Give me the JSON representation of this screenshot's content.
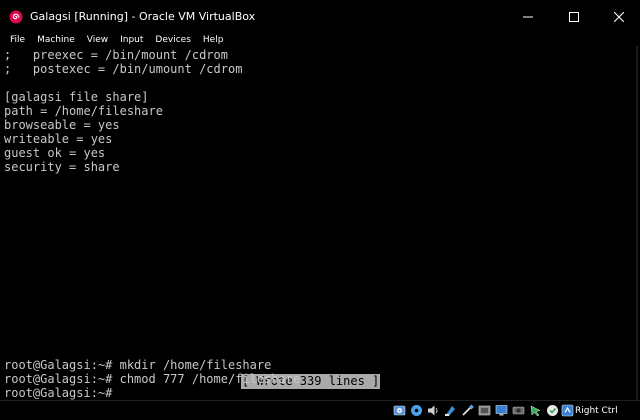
{
  "window": {
    "title": "Galagsi [Running] - Oracle VM VirtualBox"
  },
  "menubar": {
    "items": [
      "File",
      "Machine",
      "View",
      "Input",
      "Devices",
      "Help"
    ]
  },
  "terminal": {
    "lines": [
      ";   preexec = /bin/mount /cdrom",
      ";   postexec = /bin/umount /cdrom",
      "",
      "[galagsi file share]",
      "path = /home/fileshare",
      "browseable = yes",
      "writeable = yes",
      "guest ok = yes",
      "security = share"
    ],
    "status_message": "[ Wrote 339 lines ]",
    "prompt_lines": [
      "root@Galagsi:~# mkdir /home/fileshare",
      "root@Galagsi:~# chmod 777 /home/fileshare",
      "root@Galagsi:~#"
    ]
  },
  "statusbar": {
    "host_key": "Right Ctrl",
    "icons": [
      "hard-disk-icon",
      "optical-drive-icon",
      "audio-icon",
      "network-icon",
      "usb-icon",
      "shared-folders-icon",
      "display-icon",
      "video-capture-icon",
      "mouse-integration-icon",
      "host-key-indicator-icon"
    ]
  },
  "colors": {
    "background": "#000000",
    "terminal_text": "#c8c8c8",
    "status_highlight": "#aaaaaa"
  }
}
